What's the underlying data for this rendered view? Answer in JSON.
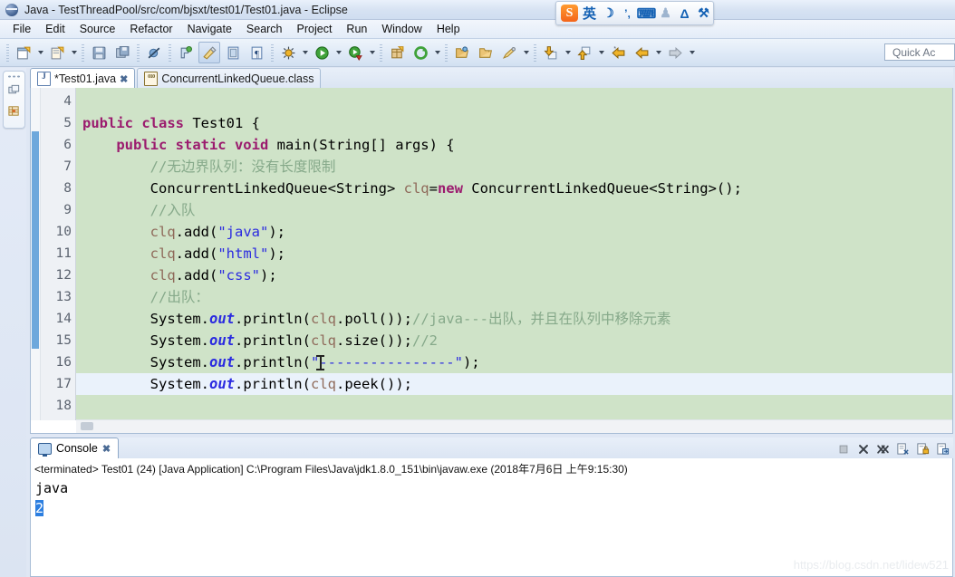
{
  "window": {
    "title": "Java - TestThreadPool/src/com/bjsxt/test01/Test01.java - Eclipse",
    "app_icon": "eclipse-icon"
  },
  "menubar": {
    "items": [
      {
        "label": "File"
      },
      {
        "label": "Edit"
      },
      {
        "label": "Source"
      },
      {
        "label": "Refactor"
      },
      {
        "label": "Navigate"
      },
      {
        "label": "Search"
      },
      {
        "label": "Project"
      },
      {
        "label": "Run"
      },
      {
        "label": "Window"
      },
      {
        "label": "Help"
      }
    ]
  },
  "ime_toolbar": {
    "logo": "S",
    "mode_label": "英",
    "icons": [
      {
        "name": "moon-icon",
        "glyph": "☽"
      },
      {
        "name": "punctuation-icon",
        "glyph": "ʼ,"
      },
      {
        "name": "soft-keyboard-icon",
        "glyph": "⌨"
      },
      {
        "name": "user-icon",
        "glyph": "♟"
      },
      {
        "name": "skin-icon",
        "glyph": "Δ"
      },
      {
        "name": "toolbox-icon",
        "glyph": "⚒"
      }
    ]
  },
  "toolbar": {
    "quick_access_placeholder": "Quick Ac",
    "buttons": [
      {
        "name": "new-wizard-button",
        "icon": "new-file-icon"
      },
      {
        "name": "new-java-class-button",
        "icon": "new-class-icon"
      },
      {
        "name": "save-button",
        "icon": "save-icon"
      },
      {
        "name": "save-all-button",
        "icon": "save-all-icon"
      },
      {
        "name": "skip-all-breakpoints-button",
        "icon": "breakpoint-skip-icon"
      },
      {
        "name": "toggle-mark-occurrences-button",
        "icon": "marker-icon"
      },
      {
        "name": "annotate-button",
        "icon": "pen-icon"
      },
      {
        "name": "open-type-button",
        "icon": "type-icon"
      },
      {
        "name": "open-task-button",
        "icon": "task-icon"
      },
      {
        "name": "show-whitespace-button",
        "icon": "pilcrow-icon"
      },
      {
        "name": "debug-button",
        "icon": "bug-icon"
      },
      {
        "name": "run-button",
        "icon": "run-icon"
      },
      {
        "name": "run-external-tools-button",
        "icon": "external-tools-icon"
      },
      {
        "name": "new-package-button",
        "icon": "package-icon"
      },
      {
        "name": "refresh-button",
        "icon": "refresh-icon"
      },
      {
        "name": "search-button",
        "icon": "search-folder-icon"
      },
      {
        "name": "open-resource-button",
        "icon": "open-folder-icon"
      },
      {
        "name": "marker-pen-button",
        "icon": "highlight-icon"
      },
      {
        "name": "next-annotation-button",
        "icon": "down-arrow-icon"
      },
      {
        "name": "previous-annotation-button",
        "icon": "up-arrow-icon"
      },
      {
        "name": "last-edit-location-button",
        "icon": "back-star-icon"
      },
      {
        "name": "back-button",
        "icon": "back-arrow-icon"
      },
      {
        "name": "forward-button",
        "icon": "forward-arrow-icon"
      }
    ]
  },
  "fastview": {
    "items": [
      {
        "name": "package-explorer-icon"
      },
      {
        "name": "outline-icon"
      }
    ]
  },
  "editor": {
    "tabs": [
      {
        "label": "*Test01.java",
        "active": true,
        "icon": "java-file-icon",
        "close": "✖"
      },
      {
        "label": "ConcurrentLinkedQueue.class",
        "active": false,
        "icon": "class-file-icon"
      }
    ],
    "first_line": 4,
    "lines": [
      {
        "num": 4,
        "fold": false,
        "current": false,
        "tokens": [
          {
            "t": "",
            "c": ""
          }
        ]
      },
      {
        "num": 5,
        "fold": false,
        "current": false,
        "tokens": [
          {
            "t": "public class ",
            "c": "kw"
          },
          {
            "t": "Test01 {",
            "c": ""
          }
        ]
      },
      {
        "num": 6,
        "fold": true,
        "current": false,
        "tokens": [
          {
            "t": "    ",
            "c": ""
          },
          {
            "t": "public static void ",
            "c": "kw"
          },
          {
            "t": "main(String[] args) {",
            "c": ""
          }
        ]
      },
      {
        "num": 7,
        "fold": false,
        "current": false,
        "tokens": [
          {
            "t": "        //无边界队列：没有长度限制",
            "c": "cm"
          }
        ]
      },
      {
        "num": 8,
        "fold": false,
        "current": false,
        "tokens": [
          {
            "t": "        ConcurrentLinkedQueue<String> ",
            "c": ""
          },
          {
            "t": "clq",
            "c": "var"
          },
          {
            "t": "=",
            "c": ""
          },
          {
            "t": "new",
            "c": "kw"
          },
          {
            "t": " ConcurrentLinkedQueue<String>();",
            "c": ""
          }
        ]
      },
      {
        "num": 9,
        "fold": false,
        "current": false,
        "tokens": [
          {
            "t": "        //入队",
            "c": "cm"
          }
        ]
      },
      {
        "num": 10,
        "fold": false,
        "current": false,
        "tokens": [
          {
            "t": "        ",
            "c": ""
          },
          {
            "t": "clq",
            "c": "var"
          },
          {
            "t": ".add(",
            "c": ""
          },
          {
            "t": "\"java\"",
            "c": "str"
          },
          {
            "t": ");",
            "c": ""
          }
        ]
      },
      {
        "num": 11,
        "fold": false,
        "current": false,
        "tokens": [
          {
            "t": "        ",
            "c": ""
          },
          {
            "t": "clq",
            "c": "var"
          },
          {
            "t": ".add(",
            "c": ""
          },
          {
            "t": "\"html\"",
            "c": "str"
          },
          {
            "t": ");",
            "c": ""
          }
        ]
      },
      {
        "num": 12,
        "fold": false,
        "current": false,
        "tokens": [
          {
            "t": "        ",
            "c": ""
          },
          {
            "t": "clq",
            "c": "var"
          },
          {
            "t": ".add(",
            "c": ""
          },
          {
            "t": "\"css\"",
            "c": "str"
          },
          {
            "t": ");",
            "c": ""
          }
        ]
      },
      {
        "num": 13,
        "fold": false,
        "current": false,
        "tokens": [
          {
            "t": "        //出队：",
            "c": "cm"
          }
        ]
      },
      {
        "num": 14,
        "fold": false,
        "current": false,
        "tokens": [
          {
            "t": "        System.",
            "c": ""
          },
          {
            "t": "out",
            "c": "fld"
          },
          {
            "t": ".println(",
            "c": ""
          },
          {
            "t": "clq",
            "c": "var"
          },
          {
            "t": ".poll());",
            "c": ""
          },
          {
            "t": "//java---出队，并且在队列中移除元素",
            "c": "cm"
          }
        ]
      },
      {
        "num": 15,
        "fold": false,
        "current": false,
        "tokens": [
          {
            "t": "        System.",
            "c": ""
          },
          {
            "t": "out",
            "c": "fld"
          },
          {
            "t": ".println(",
            "c": ""
          },
          {
            "t": "clq",
            "c": "var"
          },
          {
            "t": ".size());",
            "c": ""
          },
          {
            "t": "//2",
            "c": "cm"
          }
        ]
      },
      {
        "num": 16,
        "fold": false,
        "current": false,
        "tokens": [
          {
            "t": "        System.",
            "c": ""
          },
          {
            "t": "out",
            "c": "fld"
          },
          {
            "t": ".println(",
            "c": ""
          },
          {
            "t": "\"----------------\"",
            "c": "str"
          },
          {
            "t": ");",
            "c": ""
          }
        ]
      },
      {
        "num": 17,
        "fold": false,
        "current": true,
        "tokens": [
          {
            "t": "        System.",
            "c": ""
          },
          {
            "t": "out",
            "c": "fld"
          },
          {
            "t": ".println(",
            "c": ""
          },
          {
            "t": "clq",
            "c": "var"
          },
          {
            "t": ".peek()",
            "c": ""
          },
          {
            "t": ");",
            "c": ""
          }
        ]
      },
      {
        "num": 18,
        "fold": false,
        "current": false,
        "tokens": [
          {
            "t": "",
            "c": ""
          }
        ]
      }
    ]
  },
  "console": {
    "tab_label": "Console",
    "tab_close": "✖",
    "tools": [
      {
        "name": "terminate-button",
        "enabled": false
      },
      {
        "name": "remove-launch-button",
        "enabled": true
      },
      {
        "name": "remove-all-terminated-button",
        "enabled": true
      },
      {
        "name": "clear-console-button",
        "enabled": true
      },
      {
        "name": "scroll-lock-button",
        "enabled": true
      },
      {
        "name": "pin-console-button",
        "enabled": true
      }
    ],
    "launch_line": "<terminated> Test01 (24) [Java Application] C:\\Program Files\\Java\\jdk1.8.0_151\\bin\\javaw.exe (2018年7月6日 上午9:15:30)",
    "output": [
      {
        "text": "java",
        "selected": false
      },
      {
        "text": "2",
        "selected": true
      }
    ]
  },
  "watermark": {
    "text": "https://blog.csdn.net/lidew521"
  },
  "colors": {
    "editor_background": "#cfe3c8",
    "current_line": "#eaf2fb",
    "keyword": "#9b1b6e",
    "comment": "#86a98a",
    "string": "#2a2ae0",
    "local_variable": "#8f6a5a",
    "selection": "#2d7fe0",
    "chrome": "#dfe7f4"
  }
}
